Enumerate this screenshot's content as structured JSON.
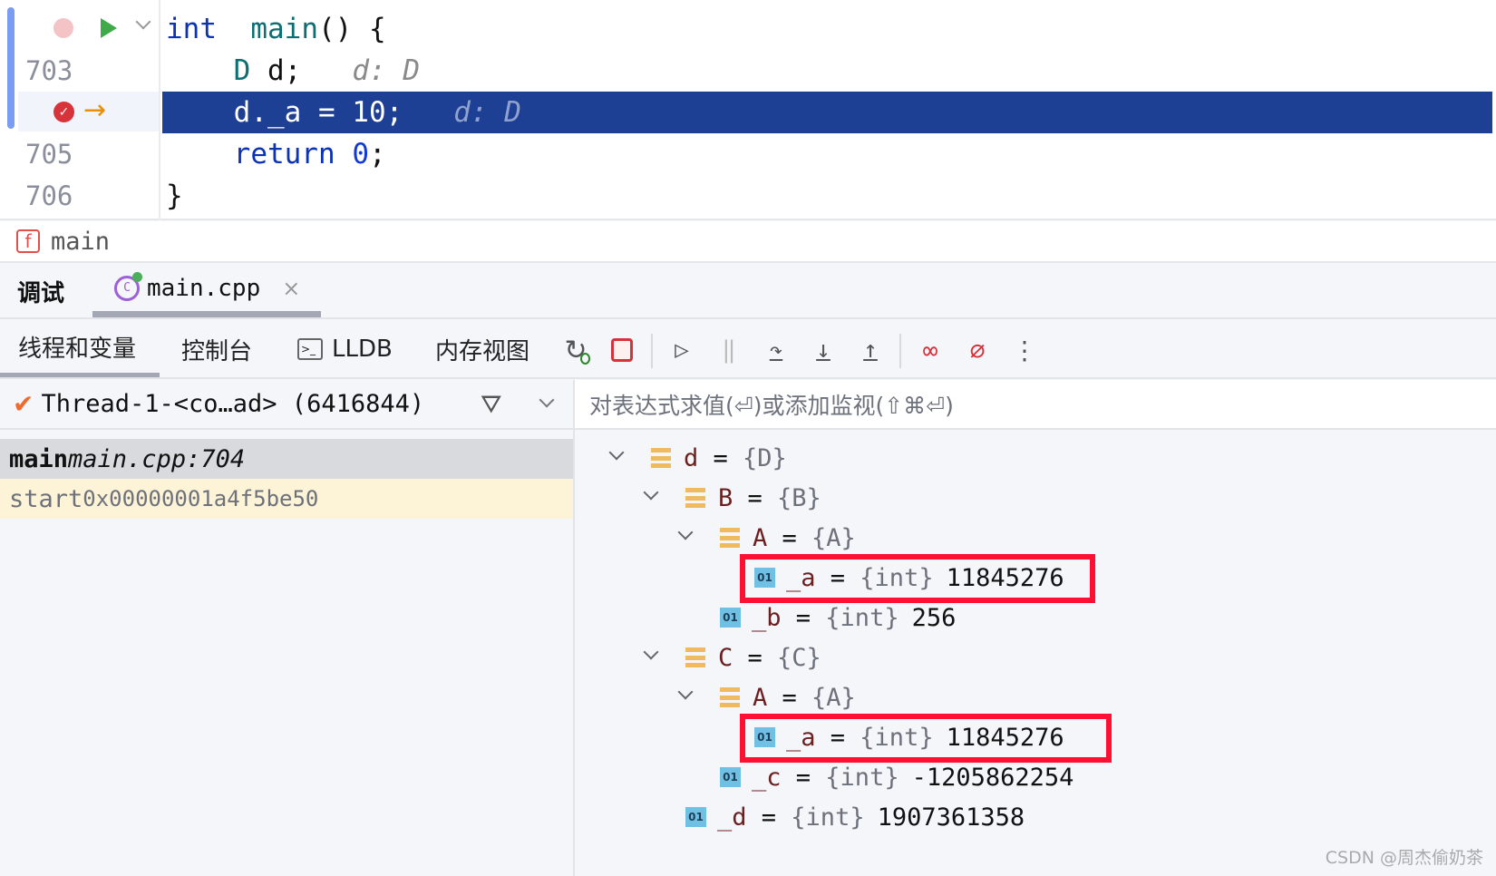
{
  "editor": {
    "lines": [
      {
        "number": "",
        "tokens": [
          [
            "kw",
            "int"
          ],
          [
            "",
            "  "
          ],
          [
            "ty",
            "main"
          ],
          [
            "",
            "() {"
          ]
        ]
      },
      {
        "number": "703",
        "tokens": [
          [
            "",
            "    "
          ],
          [
            "ty",
            "D"
          ],
          [
            "",
            " d;"
          ],
          [
            "",
            "   "
          ],
          [
            "hint",
            "d: D"
          ]
        ]
      },
      {
        "number": "",
        "tokens": [
          [
            "",
            "    d._a = 10;"
          ],
          [
            "",
            "   "
          ],
          [
            "hint",
            "d: D"
          ]
        ],
        "current": true
      },
      {
        "number": "705",
        "tokens": [
          [
            "",
            "    "
          ],
          [
            "kw",
            "return"
          ],
          [
            "",
            " "
          ],
          [
            "num",
            "0"
          ],
          [
            "",
            ";"
          ]
        ]
      },
      {
        "number": "706",
        "tokens": [
          [
            "",
            "}"
          ]
        ]
      }
    ]
  },
  "breadcrumb": {
    "icon": "function-icon",
    "label": "main",
    "icon_letter": "f"
  },
  "tabs": {
    "debug": "调试",
    "file": "main.cpp"
  },
  "toolbar": {
    "threads": "线程和变量",
    "console": "控制台",
    "lldb": "LLDB",
    "memory": "内存视图"
  },
  "thread": {
    "label": "Thread-1-<co…ad> (6416844)"
  },
  "eval": {
    "placeholder": "对表达式求值(⏎)或添加监视(⇧⌘⏎)"
  },
  "frames": [
    {
      "func": "main",
      "loc": "main.cpp:704"
    },
    {
      "func": "start",
      "loc": "0x00000001a4f5be50"
    }
  ],
  "variables": [
    {
      "level": 0,
      "kind": "obj",
      "expanded": true,
      "name": "d",
      "type": "{D}",
      "value": ""
    },
    {
      "level": 1,
      "kind": "obj",
      "expanded": true,
      "name": "B",
      "type": "{B}",
      "value": ""
    },
    {
      "level": 2,
      "kind": "obj",
      "expanded": true,
      "name": "A",
      "type": "{A}",
      "value": ""
    },
    {
      "level": 3,
      "kind": "int",
      "name": "_a",
      "type": "{int}",
      "value": "11845276",
      "highlight": true
    },
    {
      "level": 2,
      "kind": "int",
      "name": "_b",
      "type": "{int}",
      "value": "256"
    },
    {
      "level": 1,
      "kind": "obj",
      "expanded": true,
      "name": "C",
      "type": "{C}",
      "value": ""
    },
    {
      "level": 2,
      "kind": "obj",
      "expanded": true,
      "name": "A",
      "type": "{A}",
      "value": ""
    },
    {
      "level": 3,
      "kind": "int",
      "name": "_a",
      "type": "{int}",
      "value": "11845276",
      "highlight": true
    },
    {
      "level": 2,
      "kind": "int",
      "name": "_c",
      "type": "{int}",
      "value": "-1205862254"
    },
    {
      "level": 1,
      "kind": "int",
      "name": "_d",
      "type": "{int}",
      "value": "1907361358"
    }
  ],
  "int_icon_label": "01",
  "watermark": "CSDN @周杰偷奶茶",
  "colors": {
    "current_line": "#1d3f94",
    "highlight_box": "#ff1033",
    "selected_frame": "#d8dade",
    "caller_frame": "#fdf3d6"
  }
}
